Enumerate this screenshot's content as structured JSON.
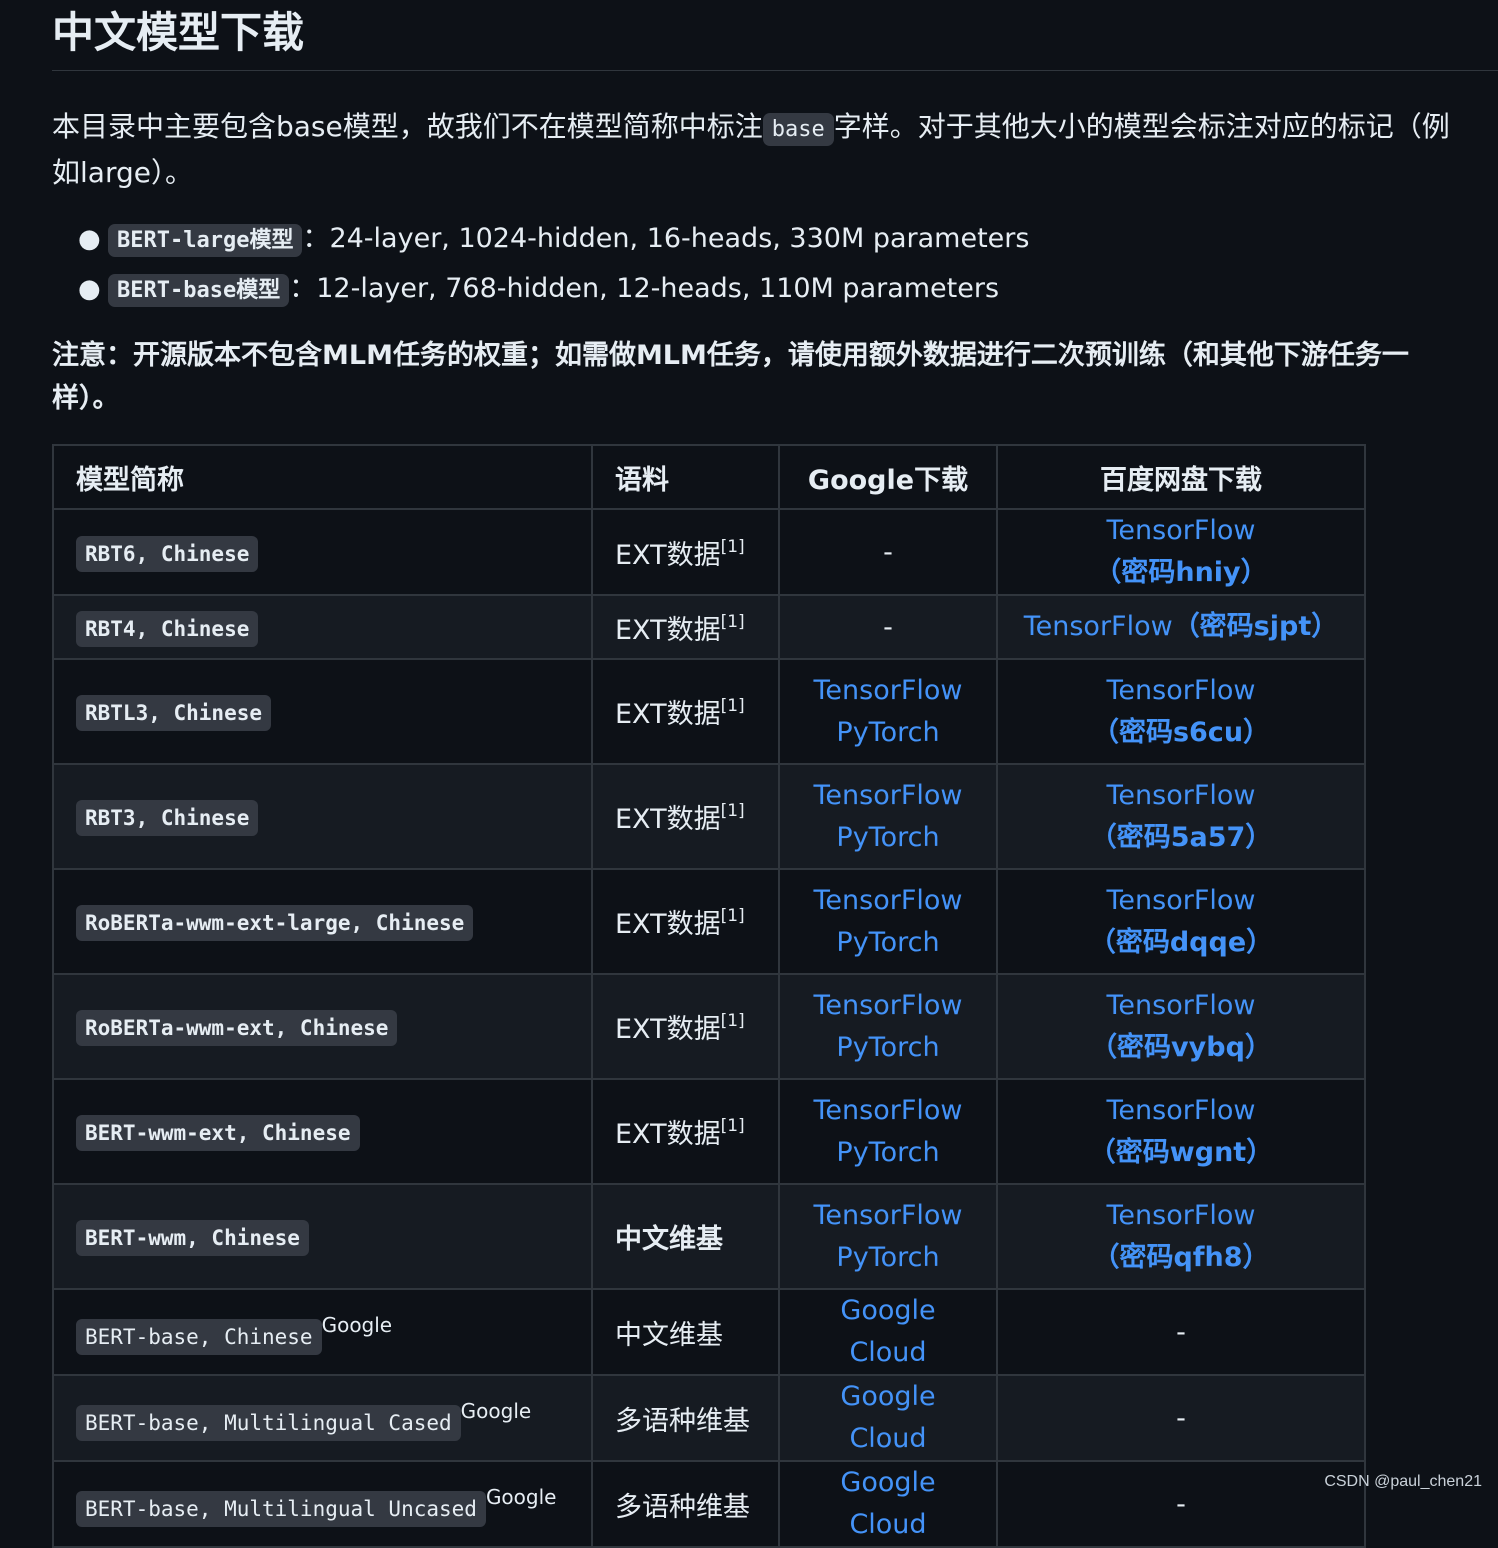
{
  "heading": "中文模型下载",
  "intro": {
    "before": "本目录中主要包含base模型，故我们不在模型简称中标注",
    "code": "base",
    "after": "字样。对于其他大小的模型会标注对应的标记（例如large）。"
  },
  "specs": [
    {
      "code": "BERT-large模型",
      "text": "：24-layer, 1024-hidden, 16-heads, 330M parameters"
    },
    {
      "code": "BERT-base模型",
      "text": "：12-layer, 768-hidden, 12-heads, 110M parameters"
    }
  ],
  "note": "注意：开源版本不包含MLM任务的权重；如需做MLM任务，请使用额外数据进行二次预训练（和其他下游任务一样）。",
  "table": {
    "headers": {
      "name": "模型简称",
      "corpus": "语料",
      "google": "Google下载",
      "baidu": "百度网盘下载"
    },
    "rows": [
      {
        "name": "RBT6, Chinese",
        "corpus": "EXT数据",
        "sup": "[1]",
        "google": "-",
        "baidu_tf": "TensorFlow",
        "baidu_pw": "（密码hniy）"
      },
      {
        "name": "RBT4, Chinese",
        "corpus": "EXT数据",
        "sup": "[1]",
        "google": "-",
        "baidu_tf": "TensorFlow",
        "baidu_pw": "（密码sjpt）"
      },
      {
        "name": "RBTL3, Chinese",
        "corpus": "EXT数据",
        "sup": "[1]",
        "google_tf": "TensorFlow",
        "google_pt": "PyTorch",
        "baidu_tf": "TensorFlow",
        "baidu_pw": "（密码s6cu）"
      },
      {
        "name": "RBT3, Chinese",
        "corpus": "EXT数据",
        "sup": "[1]",
        "google_tf": "TensorFlow",
        "google_pt": "PyTorch",
        "baidu_tf": "TensorFlow",
        "baidu_pw": "（密码5a57）"
      },
      {
        "name": "RoBERTa-wwm-ext-large, Chinese",
        "corpus": "EXT数据",
        "sup": "[1]",
        "google_tf": "TensorFlow",
        "google_pt": "PyTorch",
        "baidu_tf": "TensorFlow",
        "baidu_pw": "（密码dqqe）"
      },
      {
        "name": "RoBERTa-wwm-ext, Chinese",
        "corpus": "EXT数据",
        "sup": "[1]",
        "google_tf": "TensorFlow",
        "google_pt": "PyTorch",
        "baidu_tf": "TensorFlow",
        "baidu_pw": "（密码vybq）"
      },
      {
        "name": "BERT-wwm-ext, Chinese",
        "corpus": "EXT数据",
        "sup": "[1]",
        "google_tf": "TensorFlow",
        "google_pt": "PyTorch",
        "baidu_tf": "TensorFlow",
        "baidu_pw": "（密码wgnt）"
      },
      {
        "name": "BERT-wwm, Chinese",
        "corpus": "中文维基",
        "google_tf": "TensorFlow",
        "google_pt": "PyTorch",
        "baidu_tf": "TensorFlow",
        "baidu_pw": "（密码qfh8）"
      },
      {
        "name": "BERT-base, Chinese",
        "name_sup": "Google",
        "corpus": "中文维基",
        "google": "Google Cloud",
        "baidu": "-"
      },
      {
        "name": "BERT-base, Multilingual Cased",
        "name_sup": "Google",
        "corpus": "多语种维基",
        "google": "Google Cloud",
        "baidu": "-"
      },
      {
        "name": "BERT-base, Multilingual Uncased",
        "name_sup": "Google",
        "corpus": "多语种维基",
        "google": "Google Cloud",
        "baidu": "-"
      }
    ]
  },
  "watermark": "CSDN @paul_chen21"
}
